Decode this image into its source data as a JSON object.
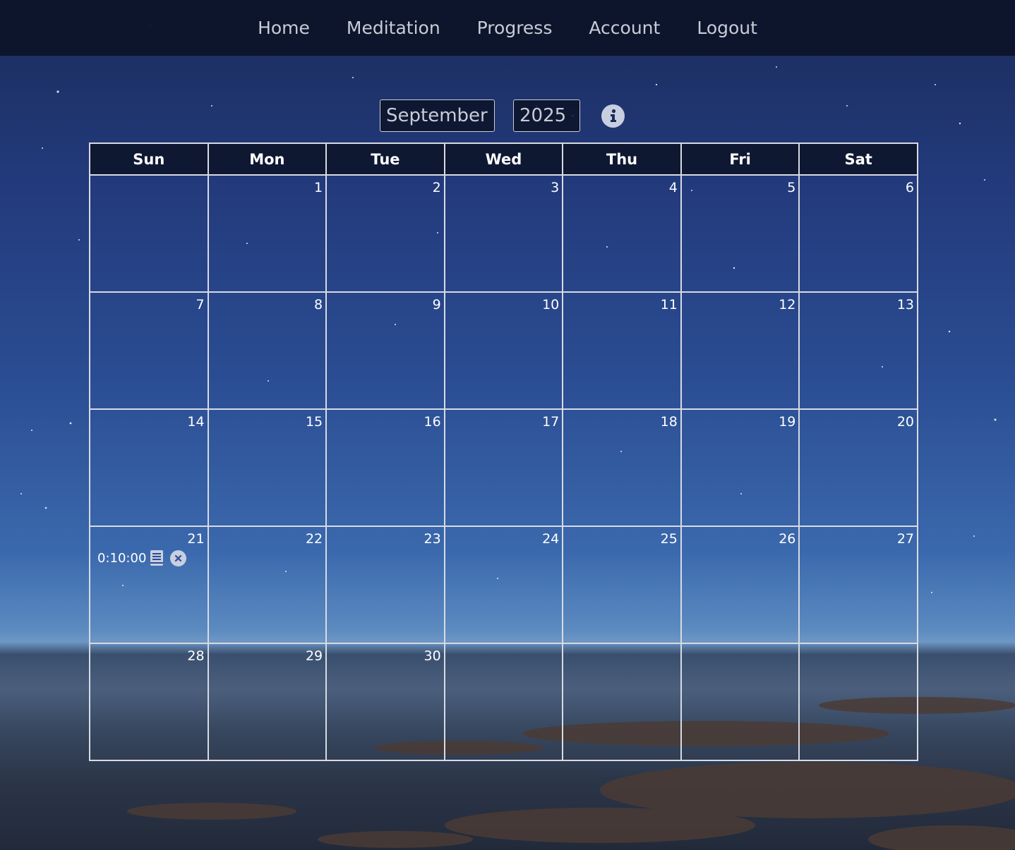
{
  "nav": {
    "items": [
      "Home",
      "Meditation",
      "Progress",
      "Account",
      "Logout"
    ]
  },
  "controls": {
    "month": "September",
    "year": "2025",
    "info_icon": "info-icon"
  },
  "calendar": {
    "weekdays": [
      "Sun",
      "Mon",
      "Tue",
      "Wed",
      "Thu",
      "Fri",
      "Sat"
    ],
    "weeks": [
      [
        "",
        "1",
        "2",
        "3",
        "4",
        "5",
        "6"
      ],
      [
        "7",
        "8",
        "9",
        "10",
        "11",
        "12",
        "13"
      ],
      [
        "14",
        "15",
        "16",
        "17",
        "18",
        "19",
        "20"
      ],
      [
        "21",
        "22",
        "23",
        "24",
        "25",
        "26",
        "27"
      ],
      [
        "28",
        "29",
        "30",
        "",
        "",
        "",
        ""
      ]
    ],
    "entries": {
      "21": {
        "duration": "0:10:00",
        "journal_icon": "book-icon",
        "delete_icon": "close-circle-icon"
      }
    }
  },
  "colors": {
    "nav_bg": "#0c1328",
    "text": "#ffffff",
    "nav_text": "#c8ccd6",
    "grid_line": "#d8dbe3",
    "icon_bg": "#c8cfe0"
  }
}
